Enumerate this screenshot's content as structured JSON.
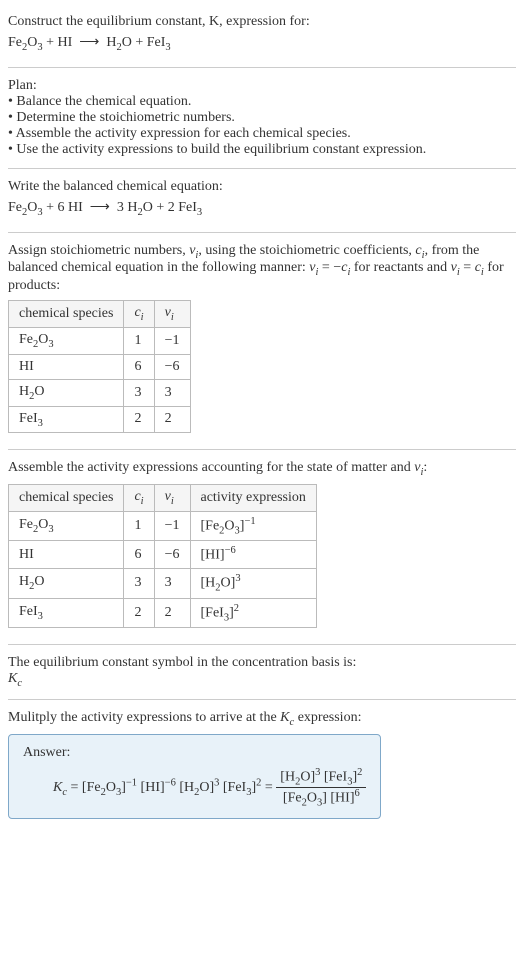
{
  "intro": {
    "line1": "Construct the equilibrium constant, K, expression for:",
    "equation": "Fe₂O₃ + HI ⟶ H₂O + FeI₃"
  },
  "plan": {
    "heading": "Plan:",
    "items": [
      "• Balance the chemical equation.",
      "• Determine the stoichiometric numbers.",
      "• Assemble the activity expression for each chemical species.",
      "• Use the activity expressions to build the equilibrium constant expression."
    ]
  },
  "balanced": {
    "heading": "Write the balanced chemical equation:",
    "equation": "Fe₂O₃ + 6 HI ⟶ 3 H₂O + 2 FeI₃"
  },
  "stoich": {
    "text": "Assign stoichiometric numbers, νᵢ, using the stoichiometric coefficients, cᵢ, from the balanced chemical equation in the following manner: νᵢ = −cᵢ for reactants and νᵢ = cᵢ for products:",
    "headers": [
      "chemical species",
      "cᵢ",
      "νᵢ"
    ],
    "rows": [
      {
        "species": "Fe₂O₃",
        "c": "1",
        "v": "−1"
      },
      {
        "species": "HI",
        "c": "6",
        "v": "−6"
      },
      {
        "species": "H₂O",
        "c": "3",
        "v": "3"
      },
      {
        "species": "FeI₃",
        "c": "2",
        "v": "2"
      }
    ]
  },
  "activity": {
    "text": "Assemble the activity expressions accounting for the state of matter and νᵢ:",
    "headers": [
      "chemical species",
      "cᵢ",
      "νᵢ",
      "activity expression"
    ],
    "rows": [
      {
        "species": "Fe₂O₃",
        "c": "1",
        "v": "−1",
        "expr_base": "[Fe₂O₃]",
        "expr_pow": "−1"
      },
      {
        "species": "HI",
        "c": "6",
        "v": "−6",
        "expr_base": "[HI]",
        "expr_pow": "−6"
      },
      {
        "species": "H₂O",
        "c": "3",
        "v": "3",
        "expr_base": "[H₂O]",
        "expr_pow": "3"
      },
      {
        "species": "FeI₃",
        "c": "2",
        "v": "2",
        "expr_base": "[FeI₃]",
        "expr_pow": "2"
      }
    ]
  },
  "symbol": {
    "line1": "The equilibrium constant symbol in the concentration basis is:",
    "line2": "K_c"
  },
  "multiply": {
    "text": "Mulitply the activity expressions to arrive at the K_c expression:"
  },
  "answer": {
    "label": "Answer:",
    "lhs": "K_c = [Fe₂O₃]⁻¹ [HI]⁻⁶ [H₂O]³ [FeI₃]² =",
    "num": "[H₂O]³ [FeI₃]²",
    "den": "[Fe₂O₃] [HI]⁶"
  },
  "chart_data": {
    "type": "table",
    "tables": [
      {
        "title": "Stoichiometric numbers",
        "columns": [
          "chemical species",
          "c_i",
          "v_i"
        ],
        "rows": [
          [
            "Fe2O3",
            1,
            -1
          ],
          [
            "HI",
            6,
            -6
          ],
          [
            "H2O",
            3,
            3
          ],
          [
            "FeI3",
            2,
            2
          ]
        ]
      },
      {
        "title": "Activity expressions",
        "columns": [
          "chemical species",
          "c_i",
          "v_i",
          "activity expression"
        ],
        "rows": [
          [
            "Fe2O3",
            1,
            -1,
            "[Fe2O3]^-1"
          ],
          [
            "HI",
            6,
            -6,
            "[HI]^-6"
          ],
          [
            "H2O",
            3,
            3,
            "[H2O]^3"
          ],
          [
            "FeI3",
            2,
            2,
            "[FeI3]^2"
          ]
        ]
      }
    ]
  }
}
